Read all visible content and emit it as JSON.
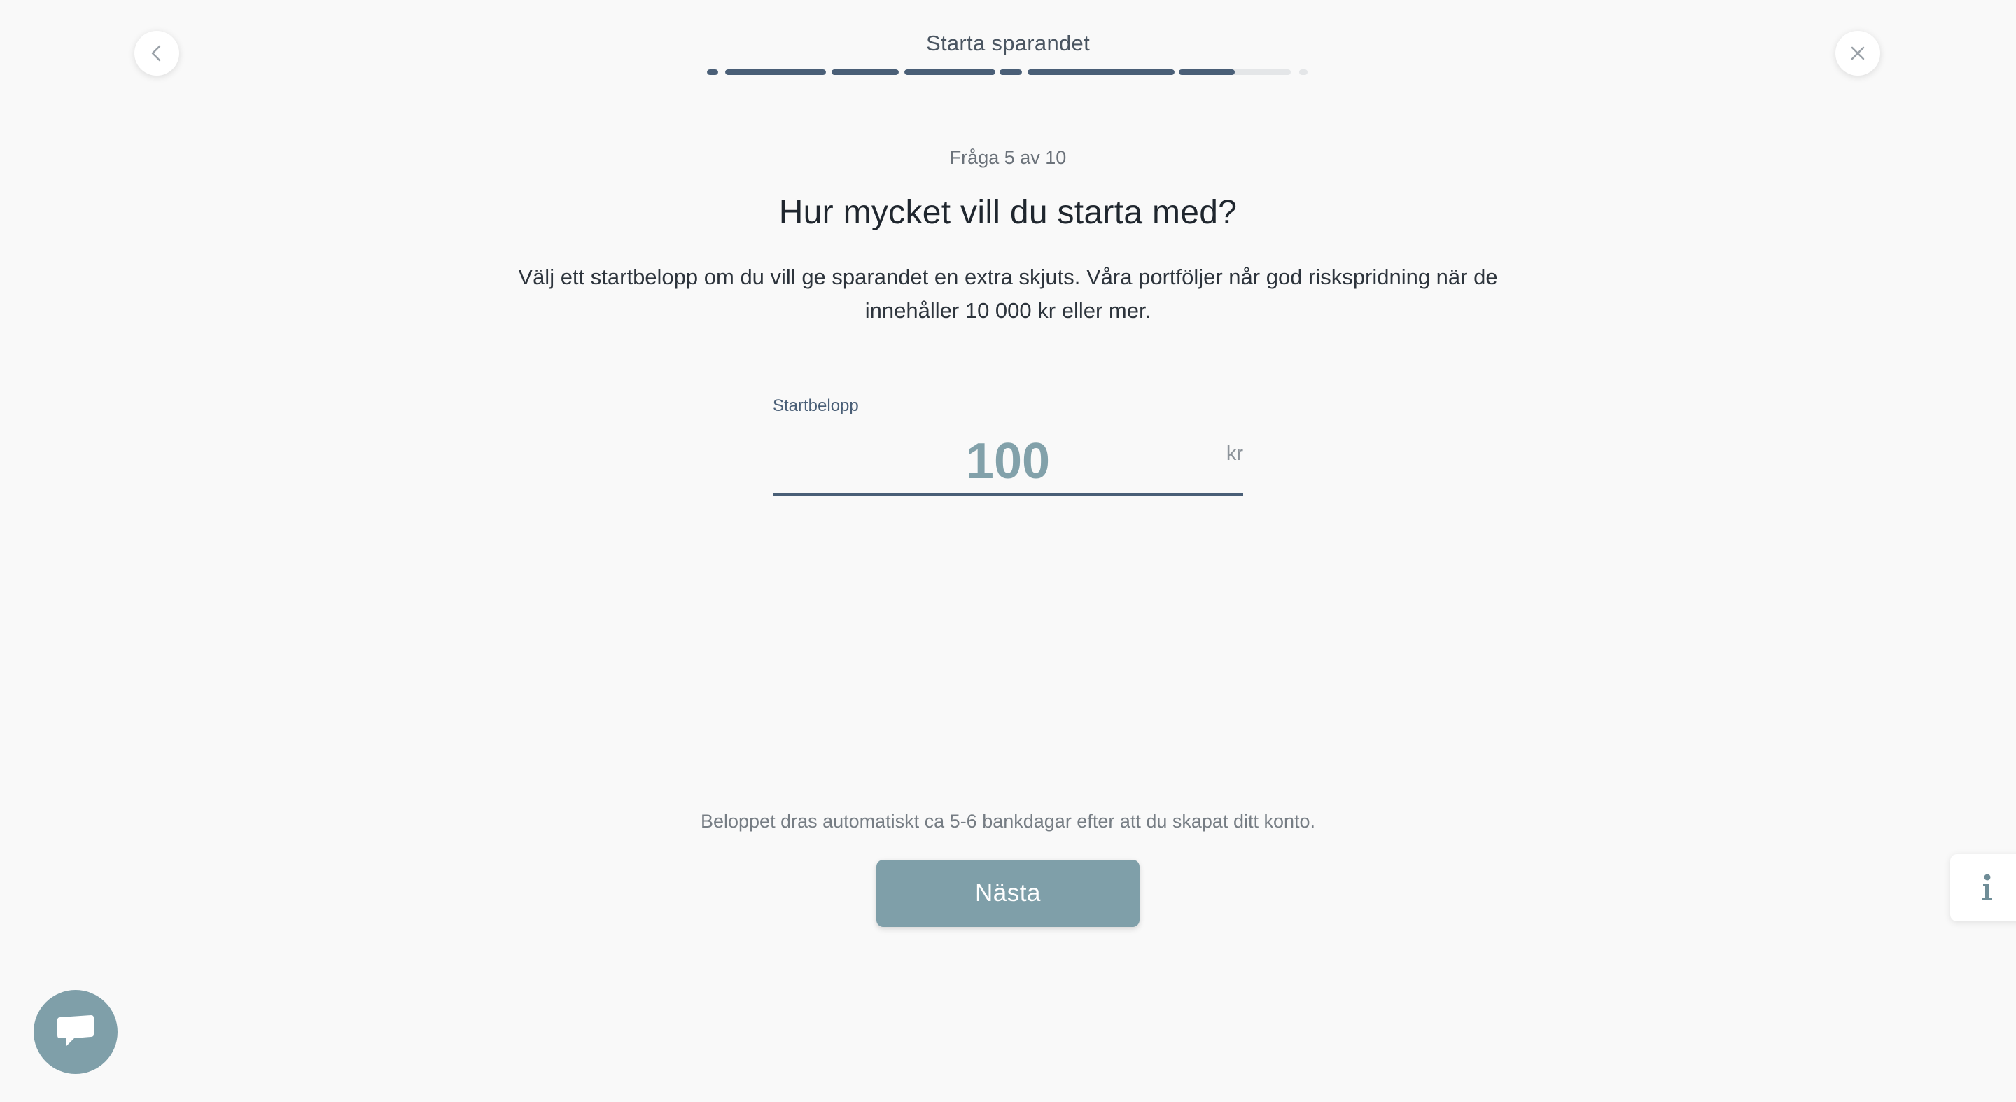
{
  "header": {
    "title": "Starta sparandet"
  },
  "progress": {
    "segments": [
      {
        "fill": 1.0
      },
      {
        "fill": 1.0
      },
      {
        "fill": 1.0
      },
      {
        "fill": 1.0
      },
      {
        "fill": 1.0
      },
      {
        "fill": 1.0
      },
      {
        "fill": 0.5
      },
      {
        "fill": 0.0
      }
    ],
    "active_color": "#4a5f77",
    "inactive_color": "#e4e6e8"
  },
  "question": {
    "counter": "Fråga 5 av 10",
    "title": "Hur mycket vill du starta med?",
    "description": "Välj ett startbelopp om du vill ge sparandet en extra skjuts. Våra portföljer når god riskspridning när de innehåller 10 000 kr eller mer."
  },
  "amount": {
    "label": "Startbelopp",
    "value": "100",
    "unit": "kr"
  },
  "footer": {
    "notice": "Beloppet dras automatiskt ca 5-6 bankdagar efter att du skapat ditt konto.",
    "next_label": "Nästa"
  },
  "icons": {
    "back": "chevron-left-icon",
    "close": "close-icon",
    "info": "info-icon",
    "chat": "chat-icon"
  },
  "colors": {
    "accent": "#4a5f77",
    "button": "#7f9fa9",
    "background": "#f9f9f9"
  }
}
